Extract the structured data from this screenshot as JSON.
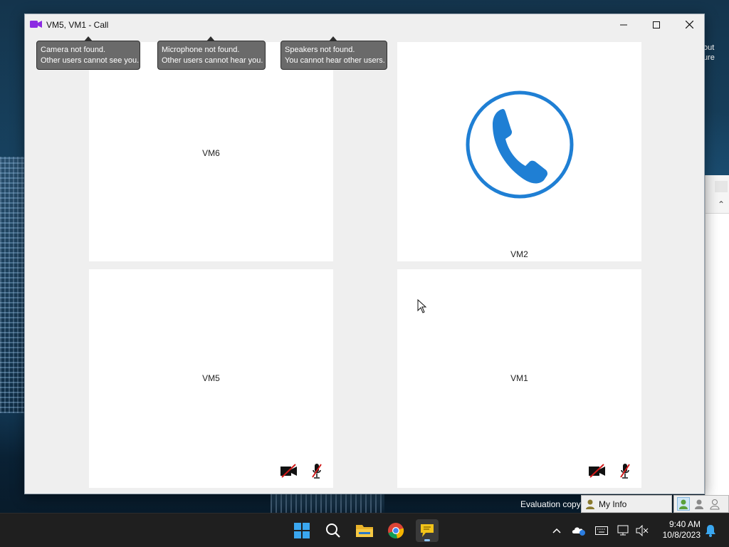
{
  "window": {
    "title": "VM5, VM1 - Call"
  },
  "tooltips": [
    {
      "line1": "Camera not found.",
      "line2": "Other users cannot see you."
    },
    {
      "line1": "Microphone not found.",
      "line2": "Other users cannot hear you."
    },
    {
      "line1": "Speakers not found.",
      "line2": "You cannot hear other users."
    }
  ],
  "tiles": [
    {
      "label": "VM6"
    },
    {
      "label": "VM2",
      "icon": "phone-icon"
    },
    {
      "label": "VM5",
      "icons": [
        "camera-off-icon",
        "microphone-off-icon"
      ]
    },
    {
      "label": "VM1",
      "icons": [
        "camera-off-icon",
        "microphone-off-icon"
      ]
    }
  ],
  "background": {
    "partial_text_line1": "out",
    "partial_text_line2": "ure"
  },
  "status_strip": {
    "eval_text": "Evaluation copy",
    "my_info_label": "My Info"
  },
  "taskbar": {
    "apps": [
      "start-icon",
      "search-icon",
      "file-explorer-icon",
      "chrome-icon",
      "chat-app-icon"
    ],
    "tray_icons": [
      "chevron-up-icon",
      "onedrive-icon",
      "keyboard-icon",
      "network-icon",
      "volume-muted-icon"
    ],
    "time": "9:40 AM",
    "date": "10/8/2023"
  },
  "colors": {
    "phone_blue": "#1f7fd4",
    "tooltip_bg": "#6a6a6a",
    "app_icon_purple": "#8b2be2",
    "mute_red": "#d11a1a"
  }
}
